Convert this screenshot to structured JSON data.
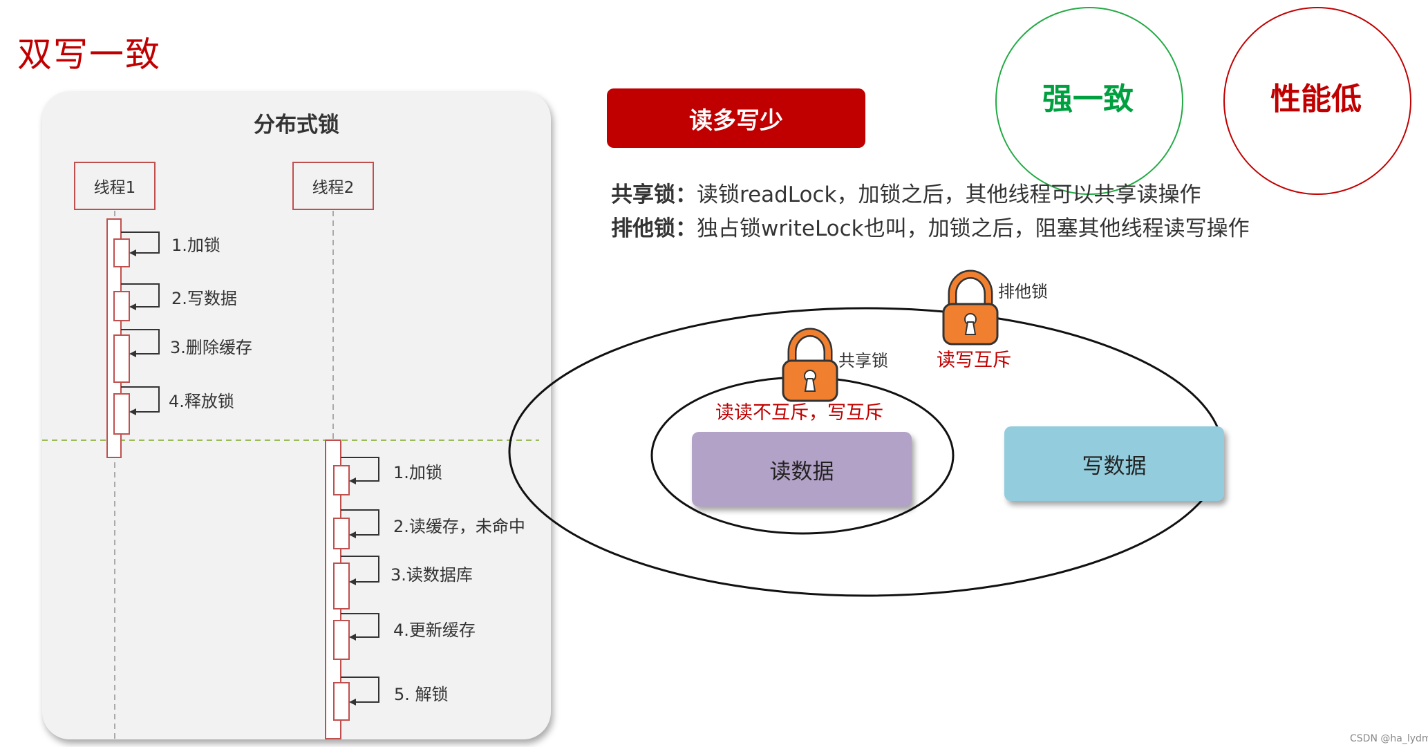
{
  "title": "双写一致",
  "sequence": {
    "title": "分布式锁",
    "participants": [
      "线程1",
      "线程2"
    ],
    "thread1_steps": [
      "1.加锁",
      "2.写数据",
      "3.删除缓存",
      "4.释放锁"
    ],
    "thread2_steps": [
      "1.加锁",
      "2.读缓存，未命中",
      "3.读数据库",
      "4.更新缓存",
      "5. 解锁"
    ]
  },
  "banner": "读多写少",
  "descriptions": [
    {
      "term": "共享锁：",
      "text": "读锁readLock，加锁之后，其他线程可以共享读操作"
    },
    {
      "term": "排他锁：",
      "text": "独占锁writeLock也叫，加锁之后，阻塞其他线程读写操作"
    }
  ],
  "circles": [
    {
      "text": "强一致",
      "color": "#00a040",
      "border": "#22aa44"
    },
    {
      "text": "性能低",
      "color": "#c00000",
      "border": "#c00000"
    }
  ],
  "lock_diagram": {
    "exclusive_label": "排他锁",
    "exclusive_rule": "读写互斥",
    "shared_label": "共享锁",
    "shared_rule": "读读不互斥，写互斥",
    "read_box": "读数据",
    "write_box": "写数据",
    "lock_icon_color": "#f08030",
    "read_box_color": "#b3a2c7",
    "write_box_color": "#93cddd"
  },
  "watermark": "CSDN @ha_lydms"
}
